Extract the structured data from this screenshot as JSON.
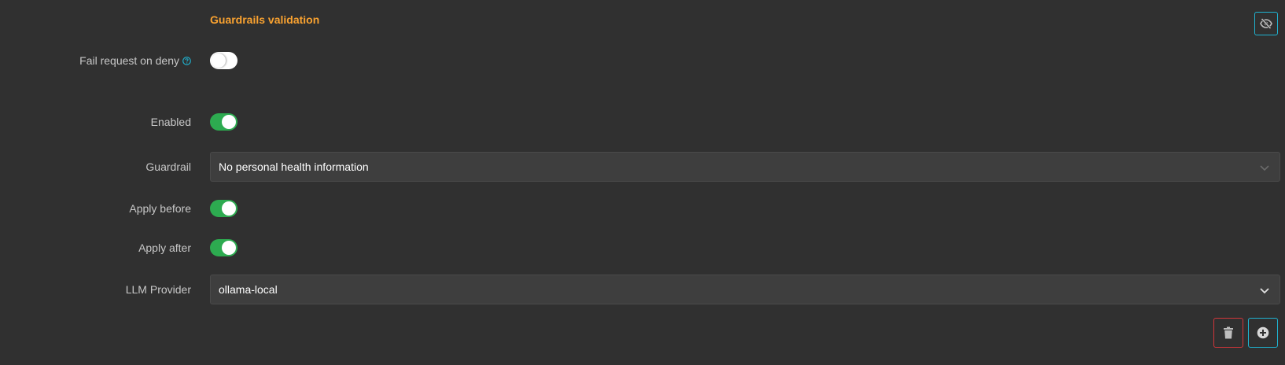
{
  "section": {
    "title": "Guardrails validation"
  },
  "fields": {
    "fail_request": {
      "label": "Fail request on deny",
      "value": false
    },
    "enabled": {
      "label": "Enabled",
      "value": true
    },
    "guardrail": {
      "label": "Guardrail",
      "value": "No personal health information"
    },
    "apply_before": {
      "label": "Apply before",
      "value": true
    },
    "apply_after": {
      "label": "Apply after",
      "value": true
    },
    "llm_provider": {
      "label": "LLM Provider",
      "value": "ollama-local"
    }
  },
  "colors": {
    "accent_title": "#f9a230",
    "toggle_on": "#2dab50",
    "info_border": "#1fb3d1",
    "danger_border": "#d1363a",
    "background": "#303030"
  },
  "icons": {
    "hide": "eye-slash-icon",
    "help": "question-circle-icon",
    "delete": "trash-icon",
    "add": "plus-circle-icon",
    "dropdown": "chevron-down-icon"
  }
}
